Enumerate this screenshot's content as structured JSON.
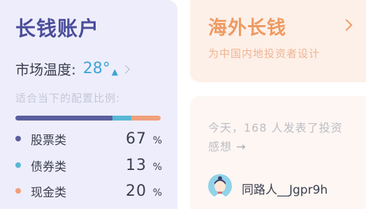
{
  "left_card": {
    "title": "长钱账户",
    "temperature_label": "市场温度:",
    "temperature_value": "28°",
    "temperature_trend_icon": "arrow-up-icon",
    "allocation_label": "适合当下的配置比例:",
    "allocations": [
      {
        "name": "股票类",
        "value": "67",
        "unit": "%",
        "color": "#5b5e9e",
        "share": 0.67
      },
      {
        "name": "债券类",
        "value": "13",
        "unit": "%",
        "color": "#57b8d4",
        "share": 0.13
      },
      {
        "name": "现金类",
        "value": "20",
        "unit": "%",
        "color": "#f0a07c",
        "share": 0.2
      }
    ]
  },
  "right_top_card": {
    "title": "海外长钱",
    "subtitle": "为中国内地投资者设计",
    "chevron_icon": "chevron-right-icon"
  },
  "right_bottom_card": {
    "feed_text": "今天，168 人发表了投资感想",
    "arrow": "→",
    "user_name": "同路人__Jgpr9h",
    "avatar_icon": "avatar-icon"
  }
}
